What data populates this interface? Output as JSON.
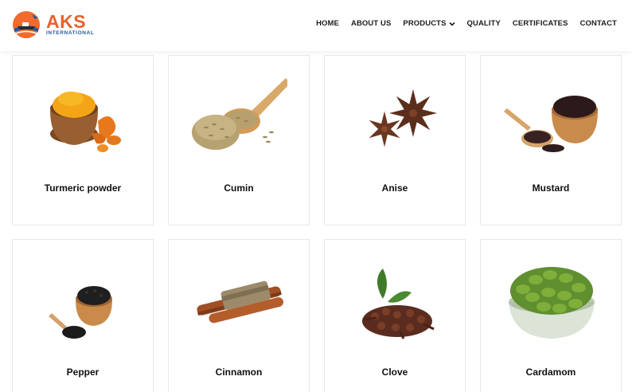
{
  "brand": {
    "name": "AKS",
    "subtitle": "INTERNATIONAL",
    "colors": {
      "primary": "#e8612c",
      "secondary": "#1f5a9e"
    }
  },
  "nav": {
    "items": [
      {
        "label": "HOME"
      },
      {
        "label": "ABOUT US"
      },
      {
        "label": "PRODUCTS",
        "has_dropdown": true
      },
      {
        "label": "QUALITY"
      },
      {
        "label": "CERTIFICATES"
      },
      {
        "label": "CONTACT"
      }
    ]
  },
  "products": [
    {
      "name": "Turmeric powder",
      "icon": "turmeric-image"
    },
    {
      "name": "Cumin",
      "icon": "cumin-image"
    },
    {
      "name": "Anise",
      "icon": "anise-image"
    },
    {
      "name": "Mustard",
      "icon": "mustard-image"
    },
    {
      "name": "Pepper",
      "icon": "pepper-image"
    },
    {
      "name": "Cinnamon",
      "icon": "cinnamon-image"
    },
    {
      "name": "Clove",
      "icon": "clove-image"
    },
    {
      "name": "Cardamom",
      "icon": "cardamom-image"
    }
  ]
}
